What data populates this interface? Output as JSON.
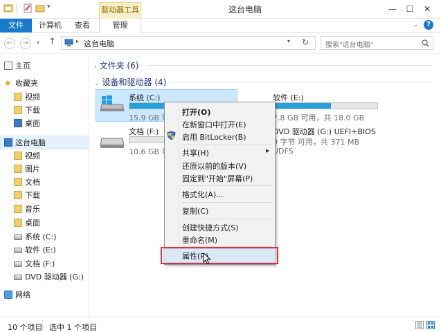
{
  "window": {
    "title": "这台电脑",
    "contextual_tab_group": "驱动器工具"
  },
  "ribbon": {
    "tabs": [
      "文件",
      "计算机",
      "查看",
      "管理"
    ]
  },
  "address": {
    "path": "这台电脑",
    "search_placeholder": "搜索\"这台电脑\""
  },
  "nav": {
    "items": [
      {
        "label": "主页",
        "icon": "home-icon"
      },
      {
        "label": "收藏夹",
        "icon": "star-icon"
      },
      {
        "label": "视频",
        "icon": "folder-icon"
      },
      {
        "label": "下载",
        "icon": "folder-icon"
      },
      {
        "label": "桌面",
        "icon": "desktop-icon"
      },
      {
        "label": "这台电脑",
        "icon": "computer-icon"
      },
      {
        "label": "视频",
        "icon": "folder-icon"
      },
      {
        "label": "图片",
        "icon": "folder-icon"
      },
      {
        "label": "文档",
        "icon": "folder-icon"
      },
      {
        "label": "下载",
        "icon": "folder-icon"
      },
      {
        "label": "音乐",
        "icon": "folder-icon"
      },
      {
        "label": "桌面",
        "icon": "folder-icon"
      },
      {
        "label": "系统 (C:)",
        "icon": "drive-icon"
      },
      {
        "label": "软件 (E:)",
        "icon": "drive-icon"
      },
      {
        "label": "文档 (F:)",
        "icon": "drive-icon"
      },
      {
        "label": "DVD 驱动器 (G:)",
        "icon": "dvd-icon"
      },
      {
        "label": "网络",
        "icon": "network-icon"
      }
    ]
  },
  "content": {
    "folders_header": "文件夹 (6)",
    "devices_header": "设备和驱动器 (4)",
    "drives": [
      {
        "name": "系统 (C:)",
        "free": "15.9 GB 可用",
        "used_fraction": 0.55
      },
      {
        "name": "软件 (E:)",
        "free": "7.8 GB 可用，共 18.0 GB",
        "used_fraction": 0.55
      },
      {
        "name": "文档 (F:)",
        "free": "10.6 GB 可用",
        "used_fraction": 0.0
      },
      {
        "name": "DVD 驱动器 (G:) UEFI+BIOS",
        "free": "0 字节 可用，共 371 MB",
        "extra": "UDFS"
      }
    ]
  },
  "context_menu": {
    "items": [
      {
        "label": "打开(O)",
        "bold": true
      },
      {
        "label": "在新窗口中打开(E)"
      },
      {
        "label": "启用 BitLocker(B)"
      },
      {
        "label": "共享(H)",
        "submenu": true
      },
      {
        "label": "还原以前的版本(V)"
      },
      {
        "label": "固定到\"开始\"屏幕(P)"
      },
      {
        "label": "格式化(A)..."
      },
      {
        "label": "复制(C)"
      },
      {
        "label": "创建快捷方式(S)"
      },
      {
        "label": "重命名(M)"
      },
      {
        "label": "属性(R)"
      }
    ]
  },
  "status": {
    "count": "10 个项目",
    "selected": "选中 1 个项目"
  }
}
